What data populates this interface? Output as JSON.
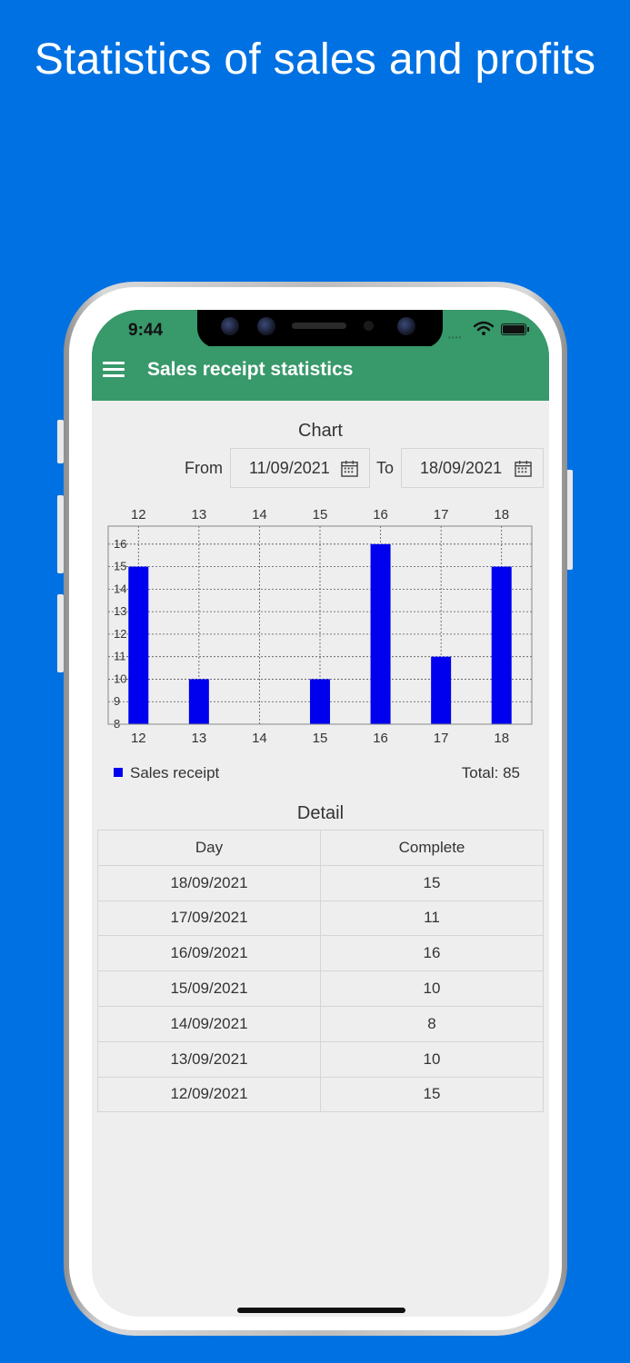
{
  "headline": "Statistics of sales and profits",
  "status_bar": {
    "time": "9:44"
  },
  "app_bar": {
    "title": "Sales receipt statistics",
    "menu_icon": "hamburger-menu-icon"
  },
  "chart_section": {
    "title": "Chart",
    "from_label": "From",
    "from_value": "11/09/2021",
    "to_label": "To",
    "to_value": "18/09/2021",
    "legend_label": "Sales receipt",
    "total": "Total: 85"
  },
  "chart_data": {
    "type": "bar",
    "categories": [
      "12",
      "13",
      "14",
      "15",
      "16",
      "17",
      "18"
    ],
    "values": [
      15,
      10,
      8,
      10,
      16,
      11,
      15
    ],
    "y_ticks": [
      "16",
      "15",
      "14",
      "13",
      "12",
      "11",
      "10",
      "9",
      "8"
    ],
    "ylim": [
      8,
      16.8
    ],
    "series": [
      {
        "name": "Sales receipt",
        "values": [
          15,
          10,
          8,
          10,
          16,
          11,
          15
        ]
      }
    ],
    "grid": true,
    "x_ticks_top": true,
    "bar_color": "#0000ee"
  },
  "detail": {
    "title": "Detail",
    "headers": [
      "Day",
      "Complete"
    ],
    "rows": [
      [
        "18/09/2021",
        "15"
      ],
      [
        "17/09/2021",
        "11"
      ],
      [
        "16/09/2021",
        "16"
      ],
      [
        "15/09/2021",
        "10"
      ],
      [
        "14/09/2021",
        "8"
      ],
      [
        "13/09/2021",
        "10"
      ],
      [
        "12/09/2021",
        "15"
      ]
    ]
  },
  "colors": {
    "background": "#0071e3",
    "app_bar": "#38996b",
    "screen": "#eeeeee",
    "bar": "#0000ee"
  }
}
